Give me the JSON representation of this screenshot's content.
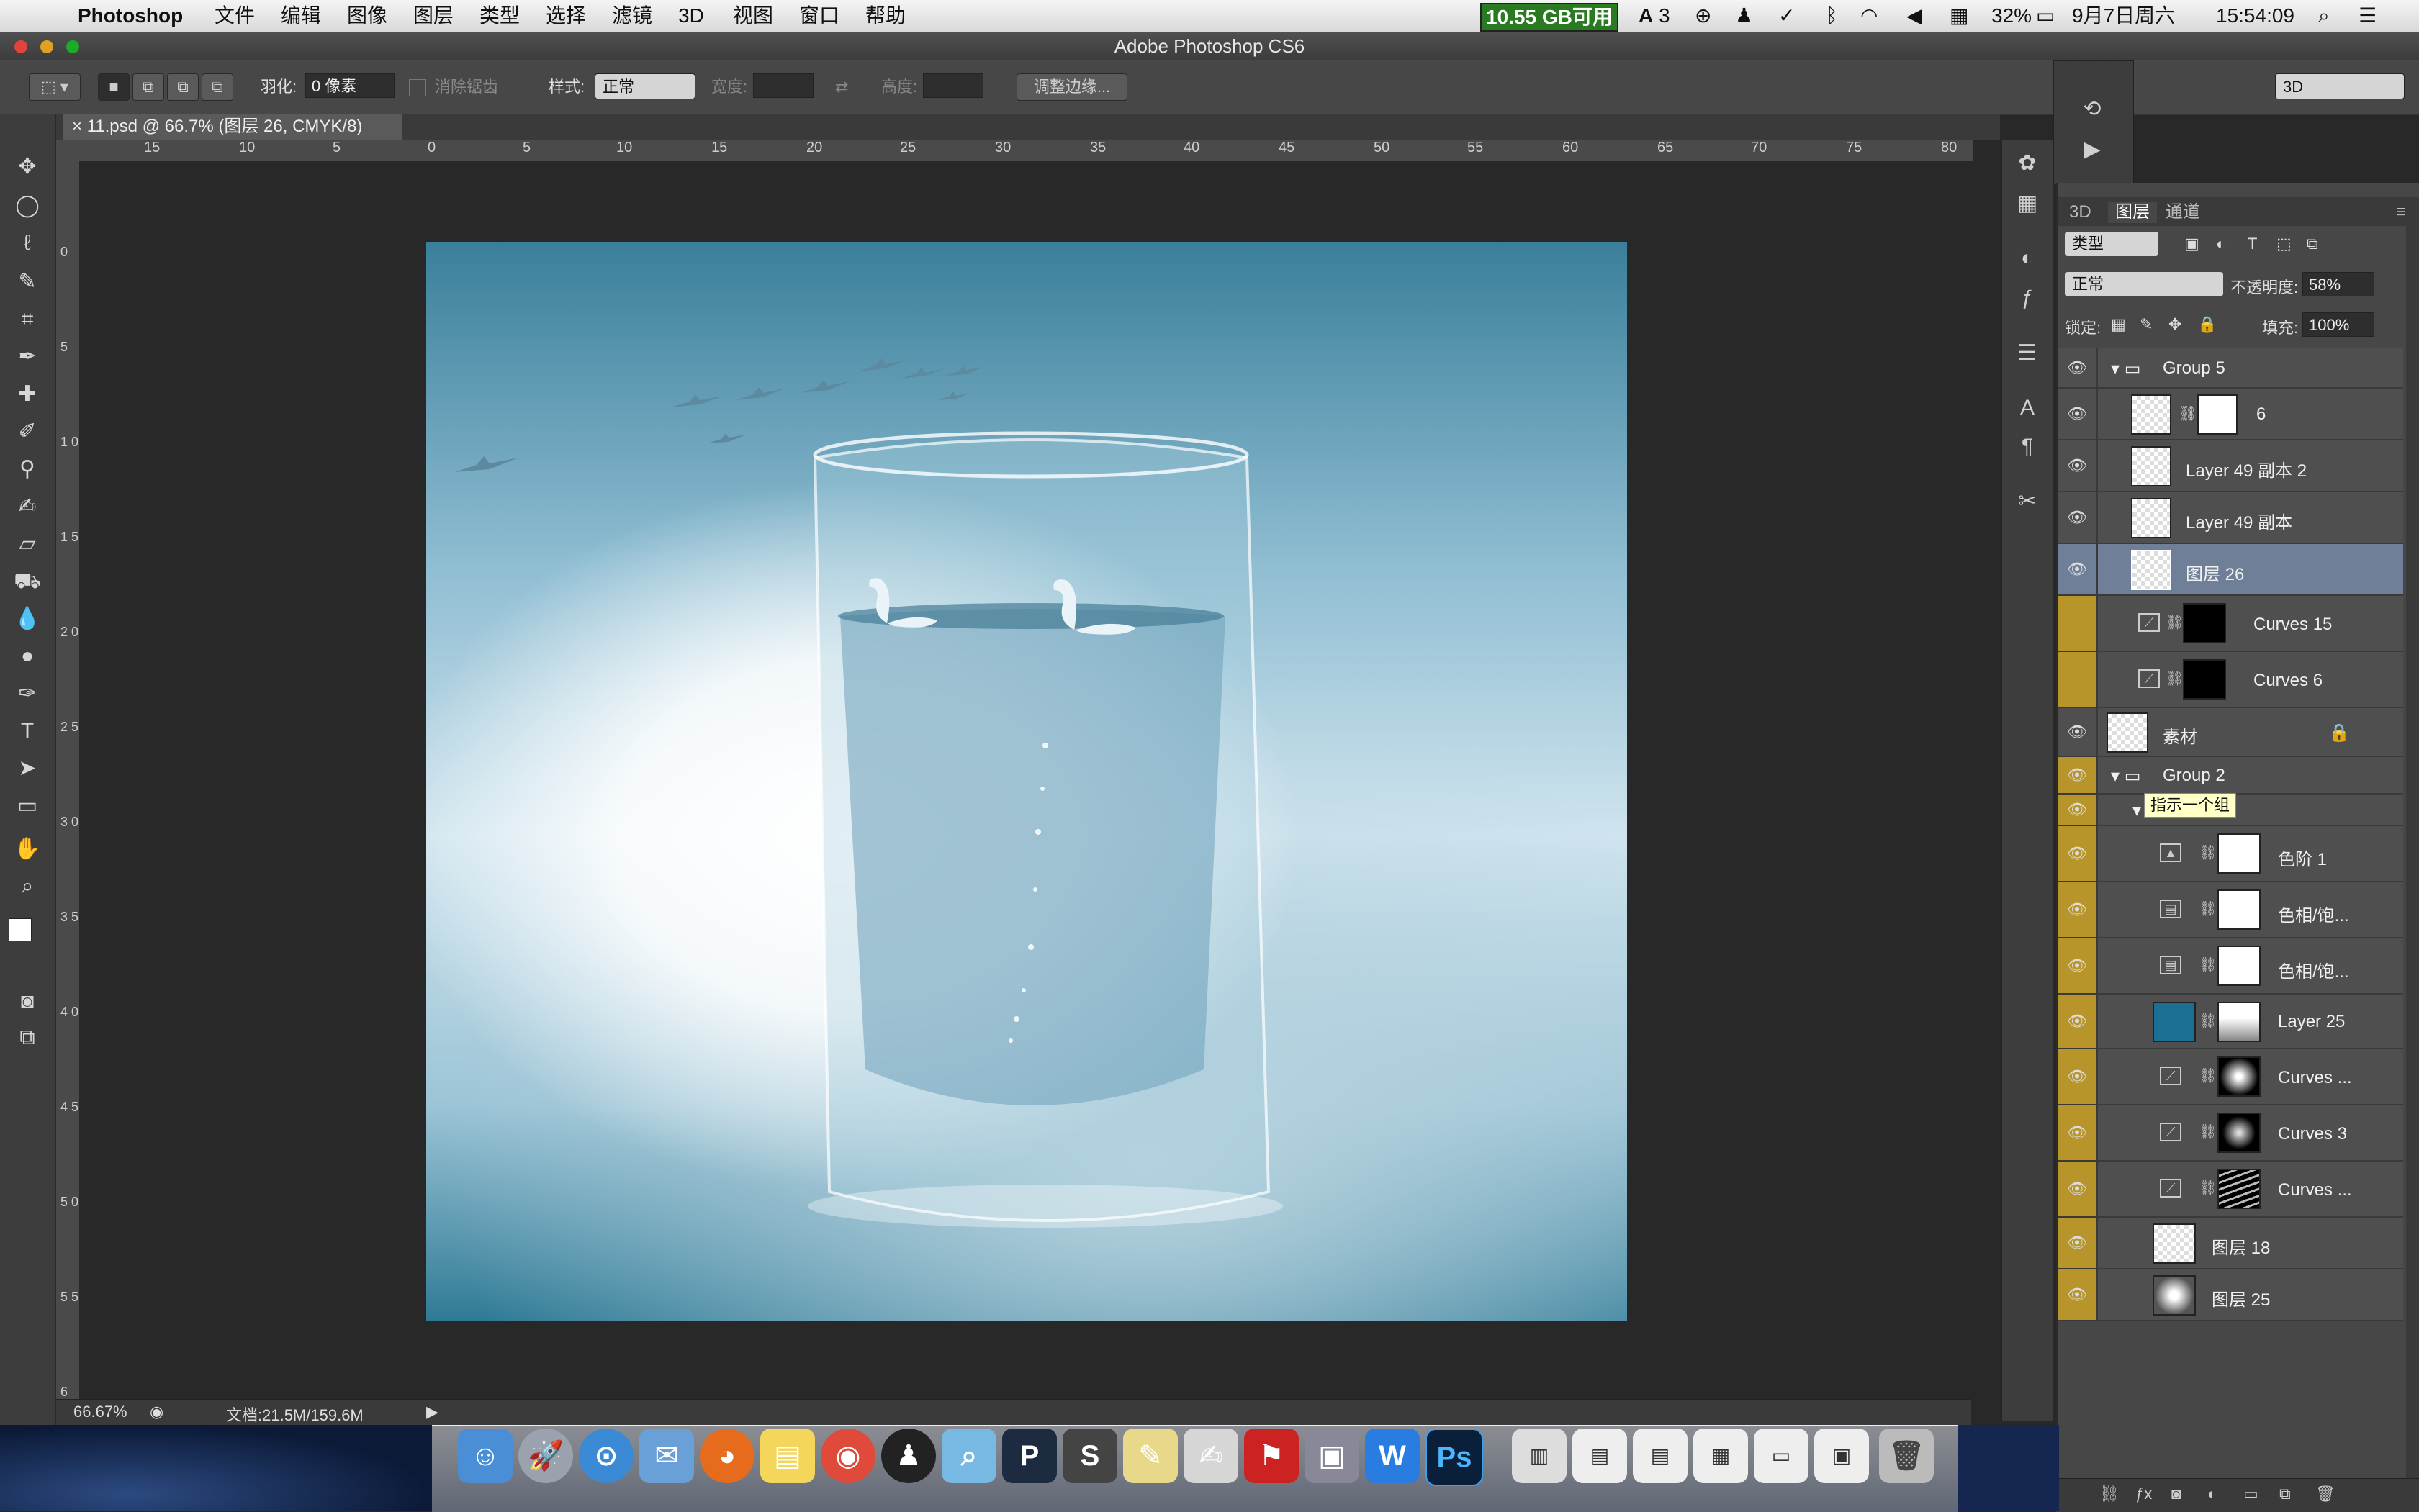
{
  "menubar": {
    "app": "Photoshop",
    "items": [
      "文件",
      "编辑",
      "图像",
      "图层",
      "类型",
      "选择",
      "滤镜",
      "3D",
      "视图",
      "窗口",
      "帮助"
    ],
    "storage": "10.55 GB可用",
    "adobe_count": "3",
    "battery": "32%",
    "date": "9月7日周六",
    "time": "15:54:09"
  },
  "window": {
    "title": "Adobe Photoshop CS6"
  },
  "options": {
    "feather_label": "羽化:",
    "feather_value": "0 像素",
    "antialias_label": "消除锯齿",
    "style_label": "样式:",
    "style_value": "正常",
    "width_label": "宽度:",
    "height_label": "高度:",
    "refine_label": "调整边缘...",
    "workspace": "3D"
  },
  "document": {
    "tab_title": "11.psd @ 66.7% (图层 26, CMYK/8)",
    "zoom": "66.67%",
    "doc_info": "文档:21.5M/159.6M"
  },
  "rulers": {
    "h": [
      "15",
      "10",
      "5",
      "0",
      "5",
      "10",
      "15",
      "20",
      "25",
      "30",
      "35",
      "40",
      "45",
      "50",
      "55",
      "60",
      "65",
      "70",
      "75",
      "80"
    ],
    "v": [
      "0",
      "5",
      "1 0",
      "1 5",
      "2 0",
      "2 5",
      "3 0",
      "3 5",
      "4 0",
      "4 5",
      "5 0",
      "5 5",
      "6"
    ]
  },
  "layers_panel": {
    "tabs": [
      "3D",
      "图层",
      "通道"
    ],
    "active_tab": "图层",
    "filter_kind": "类型",
    "blend_mode": "正常",
    "opacity_label": "不透明度:",
    "opacity": "58%",
    "lock_label": "锁定:",
    "fill_label": "填充:",
    "fill": "100%",
    "tooltip": "指示一个组",
    "layers": [
      {
        "name": "Group 5",
        "type": "group",
        "visible": true,
        "gold": false
      },
      {
        "name": "6",
        "type": "masked",
        "visible": true,
        "gold": false
      },
      {
        "name": "Layer 49 副本 2",
        "type": "pixel",
        "visible": true,
        "gold": false
      },
      {
        "name": "Layer 49 副本",
        "type": "pixel",
        "visible": true,
        "gold": false
      },
      {
        "name": "图层 26",
        "type": "pixel",
        "visible": true,
        "gold": false,
        "selected": true
      },
      {
        "name": "Curves 15",
        "type": "adjust",
        "visible": false,
        "gold": true
      },
      {
        "name": "Curves 6",
        "type": "adjust",
        "visible": false,
        "gold": true
      },
      {
        "name": "素材",
        "type": "locked",
        "visible": true,
        "gold": false
      },
      {
        "name": "Group 2",
        "type": "group",
        "visible": true,
        "gold": true
      },
      {
        "name": "",
        "type": "subgroup",
        "visible": true,
        "gold": true
      },
      {
        "name": "色阶 1",
        "type": "adjust",
        "visible": true,
        "gold": true
      },
      {
        "name": "色相/饱...",
        "type": "adjust",
        "visible": true,
        "gold": true
      },
      {
        "name": "色相/饱...",
        "type": "adjust",
        "visible": true,
        "gold": true
      },
      {
        "name": "Layer 25",
        "type": "fill",
        "visible": true,
        "gold": true
      },
      {
        "name": "Curves ...",
        "type": "adjust",
        "visible": true,
        "gold": true
      },
      {
        "name": "Curves 3",
        "type": "adjust",
        "visible": true,
        "gold": true
      },
      {
        "name": "Curves ...",
        "type": "adjust",
        "visible": true,
        "gold": true
      },
      {
        "name": "图层 18",
        "type": "pixel",
        "visible": true,
        "gold": true
      },
      {
        "name": "图层 25",
        "type": "pixel",
        "visible": true,
        "gold": true
      }
    ]
  },
  "colors": {
    "gold": "#b8952a",
    "selected": "#6f7f98",
    "fg": "#ffffff",
    "bg": "#8fae3a"
  }
}
